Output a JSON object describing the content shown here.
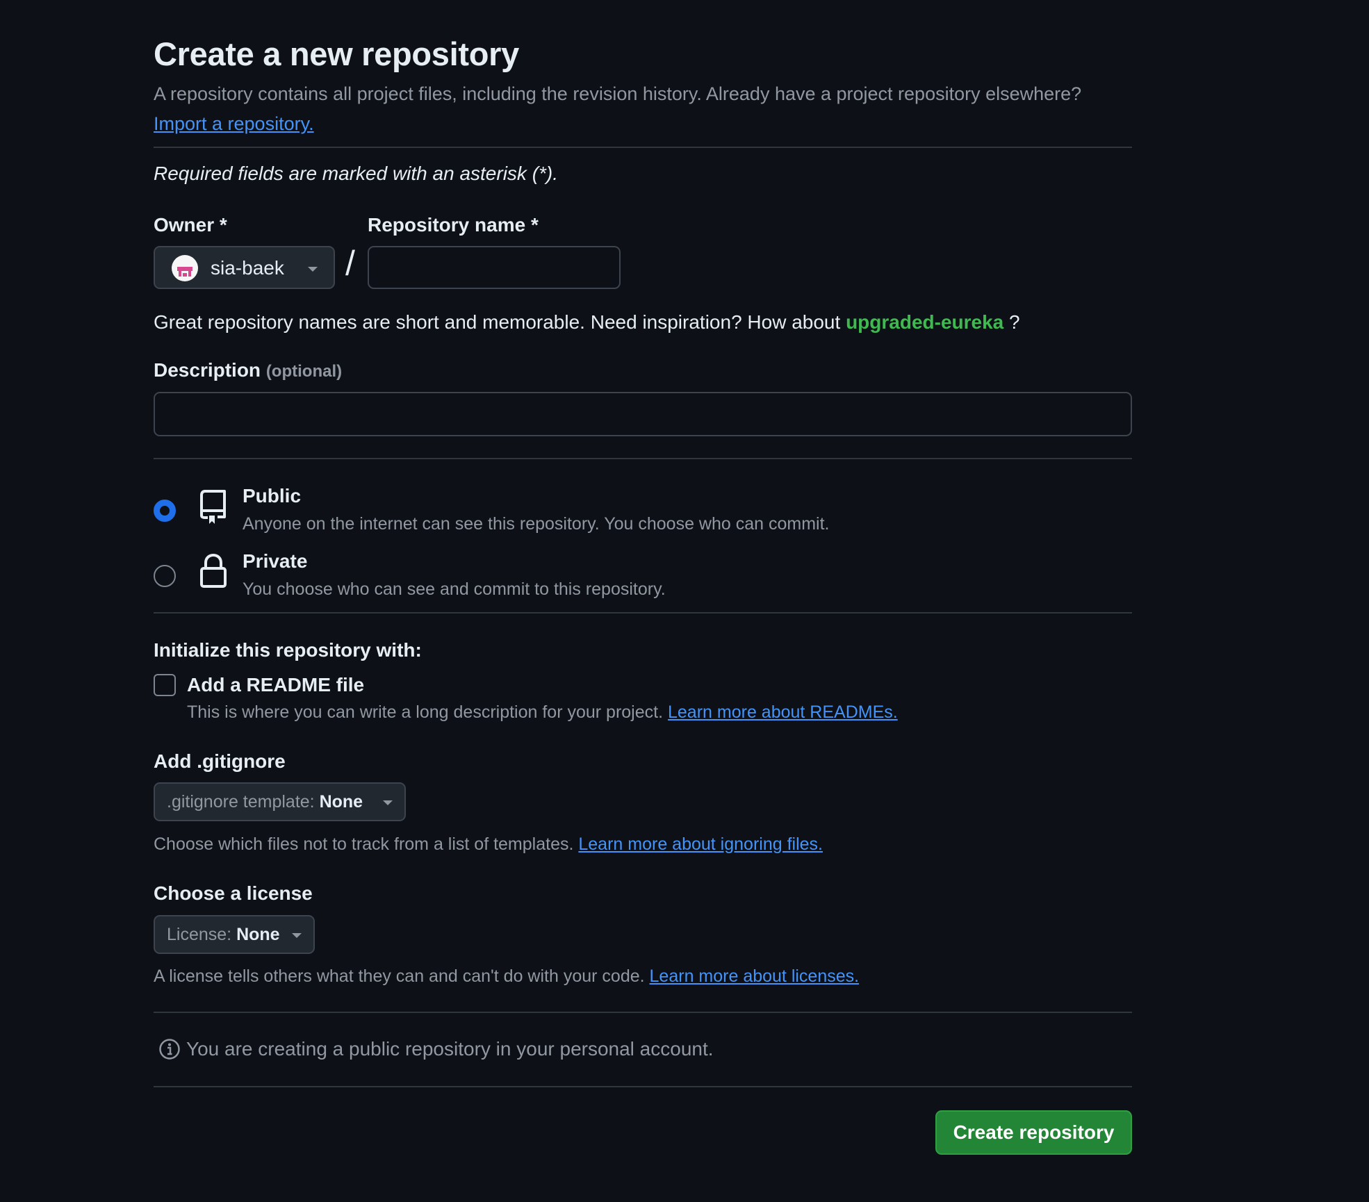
{
  "page": {
    "title": "Create a new repository",
    "intro_text": "A repository contains all project files, including the revision history. Already have a project repository elsewhere?",
    "import_link": "Import a repository.",
    "required_note": "Required fields are marked with an asterisk (*)."
  },
  "owner": {
    "label": "Owner *",
    "value": "sia-baek",
    "avatar_icon": "identicon-avatar"
  },
  "separator": "/",
  "repo_name": {
    "label": "Repository name *",
    "value": "",
    "placeholder": ""
  },
  "name_hint": {
    "text": "Great repository names are short and memorable. Need inspiration? How about",
    "suggestion": "upgraded-eureka",
    "suffix": "?"
  },
  "description": {
    "label": "Description",
    "optional": "(optional)",
    "value": "",
    "placeholder": ""
  },
  "visibility": {
    "selected": "public",
    "options": [
      {
        "id": "public",
        "title": "Public",
        "description": "Anyone on the internet can see this repository. You choose who can commit.",
        "icon": "repo-icon"
      },
      {
        "id": "private",
        "title": "Private",
        "description": "You choose who can see and commit to this repository.",
        "icon": "lock-icon"
      }
    ]
  },
  "initialize": {
    "heading": "Initialize this repository with:",
    "readme": {
      "label": "Add a README file",
      "checked": false,
      "description": "This is where you can write a long description for your project.",
      "link": "Learn more about READMEs."
    }
  },
  "gitignore": {
    "heading": "Add .gitignore",
    "select_prefix": ".gitignore template:",
    "select_value": "None",
    "description": "Choose which files not to track from a list of templates.",
    "link": "Learn more about ignoring files."
  },
  "license": {
    "heading": "Choose a license",
    "select_prefix": "License:",
    "select_value": "None",
    "description": "A license tells others what they can and can't do with your code.",
    "link": "Learn more about licenses."
  },
  "info": {
    "icon": "info-icon",
    "text": "You are creating a public repository in your personal account."
  },
  "submit": {
    "label": "Create repository"
  },
  "colors": {
    "background": "#0d1117",
    "text": "#e6edf3",
    "muted": "#9198a1",
    "border": "#3d444d",
    "link": "#4493f8",
    "accent_green": "#3fb950",
    "button_green": "#238636",
    "radio_blue": "#1f6feb"
  }
}
